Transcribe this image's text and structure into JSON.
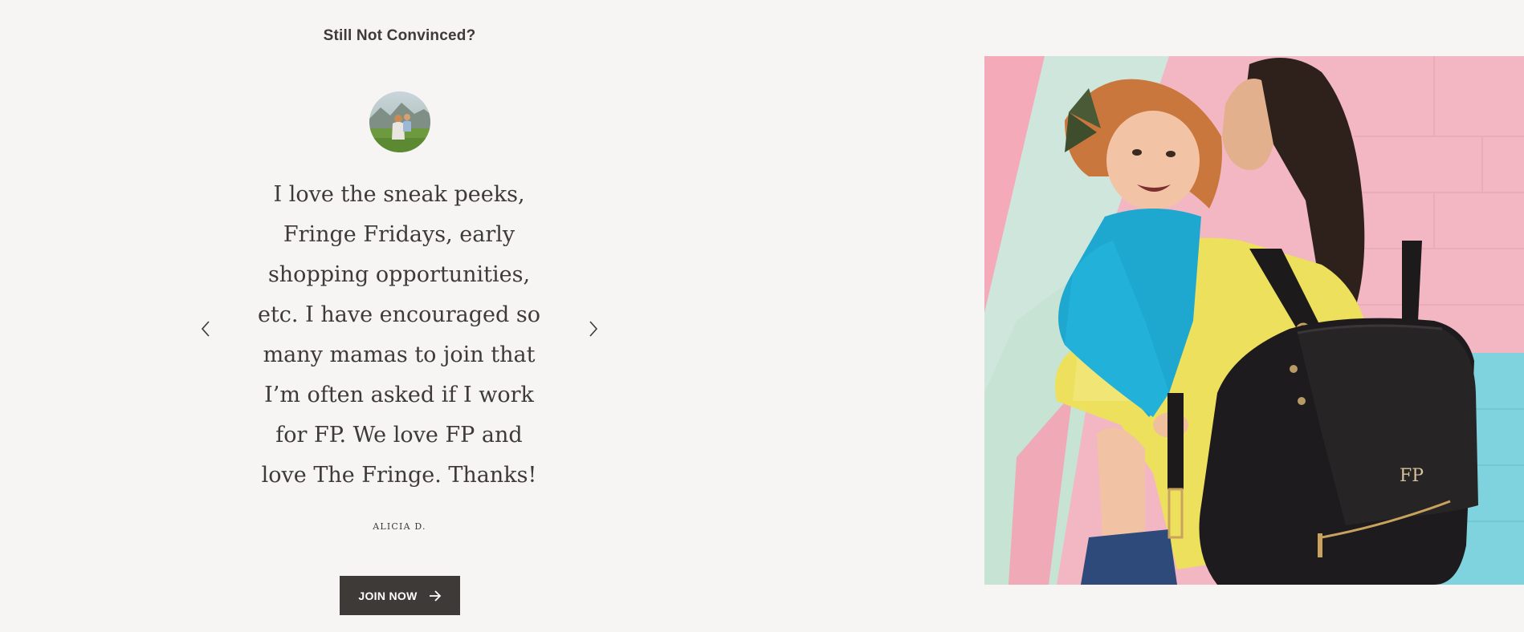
{
  "section": {
    "heading": "Still Not Convinced?"
  },
  "testimonial": {
    "quote": "I love the sneak peeks, Fringe Fridays, early shopping opportunities, etc. I have encouraged so many mamas to join that I’m often asked if I work for FP. We love FP and love The Fringe. Thanks!",
    "author": "ALICIA D."
  },
  "cta": {
    "label": "JOIN NOW"
  },
  "photo": {
    "bag_logo": "FP"
  },
  "icons": {
    "prev": "chevron-left-icon",
    "next": "chevron-right-icon",
    "cta": "arrow-right-icon"
  },
  "colors": {
    "background": "#f6f5f3",
    "text": "#3d3a38",
    "button": "#3d3a38",
    "button_text": "#ffffff"
  }
}
